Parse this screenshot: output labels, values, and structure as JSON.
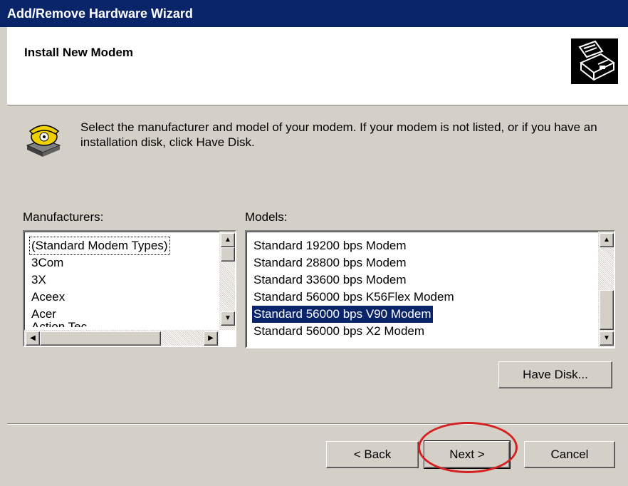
{
  "window": {
    "title": "Add/Remove Hardware Wizard"
  },
  "header": {
    "title": "Install New Modem",
    "icon": "hardware-wizard-icon"
  },
  "instruction": {
    "icon": "telephone-modem-icon",
    "text": "Select the manufacturer and model of your modem. If your modem is not listed, or if you have an installation disk, click Have Disk."
  },
  "manufacturers": {
    "label": "Manufacturers:",
    "items": [
      "(Standard Modem Types)",
      "3Com",
      "3X",
      "Aceex",
      "Acer",
      "Action Tec"
    ],
    "selected": "(Standard Modem Types)"
  },
  "models": {
    "label": "Models:",
    "items": [
      "Standard 19200 bps Modem",
      "Standard 28800 bps Modem",
      "Standard 33600 bps Modem",
      "Standard 56000 bps K56Flex Modem",
      "Standard 56000 bps V90 Modem",
      "Standard 56000 bps X2 Modem"
    ],
    "selected": "Standard 56000 bps V90 Modem"
  },
  "buttons": {
    "have_disk": "Have Disk...",
    "back": "< Back",
    "next": "Next >",
    "cancel": "Cancel"
  },
  "annotation": {
    "shape": "red-ellipse-around-next",
    "color": "#d42020"
  },
  "colors": {
    "titlebar": "#0a246a",
    "selection": "#0a246a",
    "face": "#d4d0c8"
  }
}
